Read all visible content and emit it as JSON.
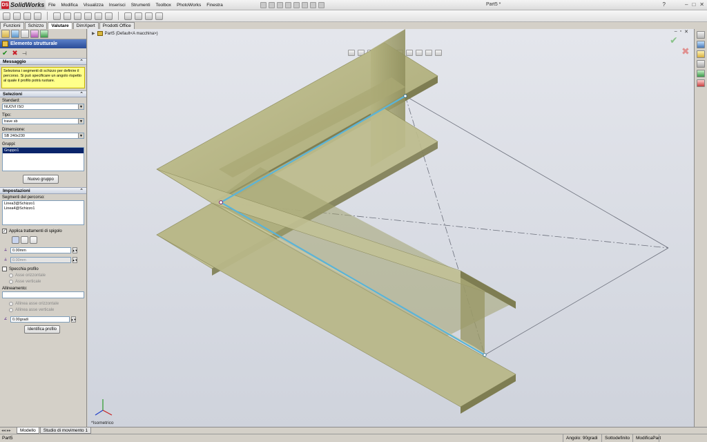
{
  "app": {
    "name": "SolidWorks",
    "doc_title": "Part5 *"
  },
  "menu": [
    "File",
    "Modifica",
    "Visualizza",
    "Inserisci",
    "Strumenti",
    "Toolbox",
    "PhotoWorks",
    "Finestra"
  ],
  "tabs": [
    "Funzioni",
    "Schizzo",
    "Valutare",
    "DimXpert",
    "Prodotti Office"
  ],
  "active_tab": "Valutare",
  "feature_tree_path": "Part5  (Default<A macchina>)",
  "property_manager": {
    "title": "Elemento strutturale",
    "message": {
      "header": "Messaggio",
      "text": "Seleziona i segmenti di schizzo per definire il percorso. Si può specificare un angolo rispetto al quale il profilo potrà ruotare."
    },
    "selections": {
      "header": "Selezioni",
      "standard_label": "Standard:",
      "standard_value": "NUOVI ISO",
      "type_label": "Tipo:",
      "type_value": "trave sb",
      "size_label": "Dimensione:",
      "size_value": "SB 240x230",
      "groups_label": "Gruppi:",
      "groups": [
        "Gruppo1"
      ],
      "new_group_button": "Nuovo gruppo"
    },
    "settings": {
      "header": "Impostazioni",
      "path_segments_label": "Segmenti del percorso:",
      "path_segments": [
        "Linea3@Schizzo1",
        "Linea4@Schizzo1"
      ],
      "apply_corner_label": "Applica trattamenti di spigolo",
      "gap1_value": "0.00mm",
      "gap2_value": "0.00mm",
      "mirror_label": "Specchia profilo",
      "horizontal_axis_label": "Asse orizzontale",
      "vertical_axis_label": "Asse verticale",
      "alignment_label": "Allineamento:",
      "align_horizontal_label": "Allinea asse orizzontale",
      "align_vertical_label": "Allinea asse verticale",
      "rotation_value": "0.00gradi",
      "locate_profile_button": "Identifica profilo"
    }
  },
  "viewport": {
    "view_label": "*Isometrico"
  },
  "bottom_tabs": [
    "Modello",
    "Studio di movimento 1"
  ],
  "status": {
    "left": "Part5",
    "angle": "Angolo: 90gradi",
    "state": "Sottodefinito",
    "mode": "ModificaPart"
  }
}
